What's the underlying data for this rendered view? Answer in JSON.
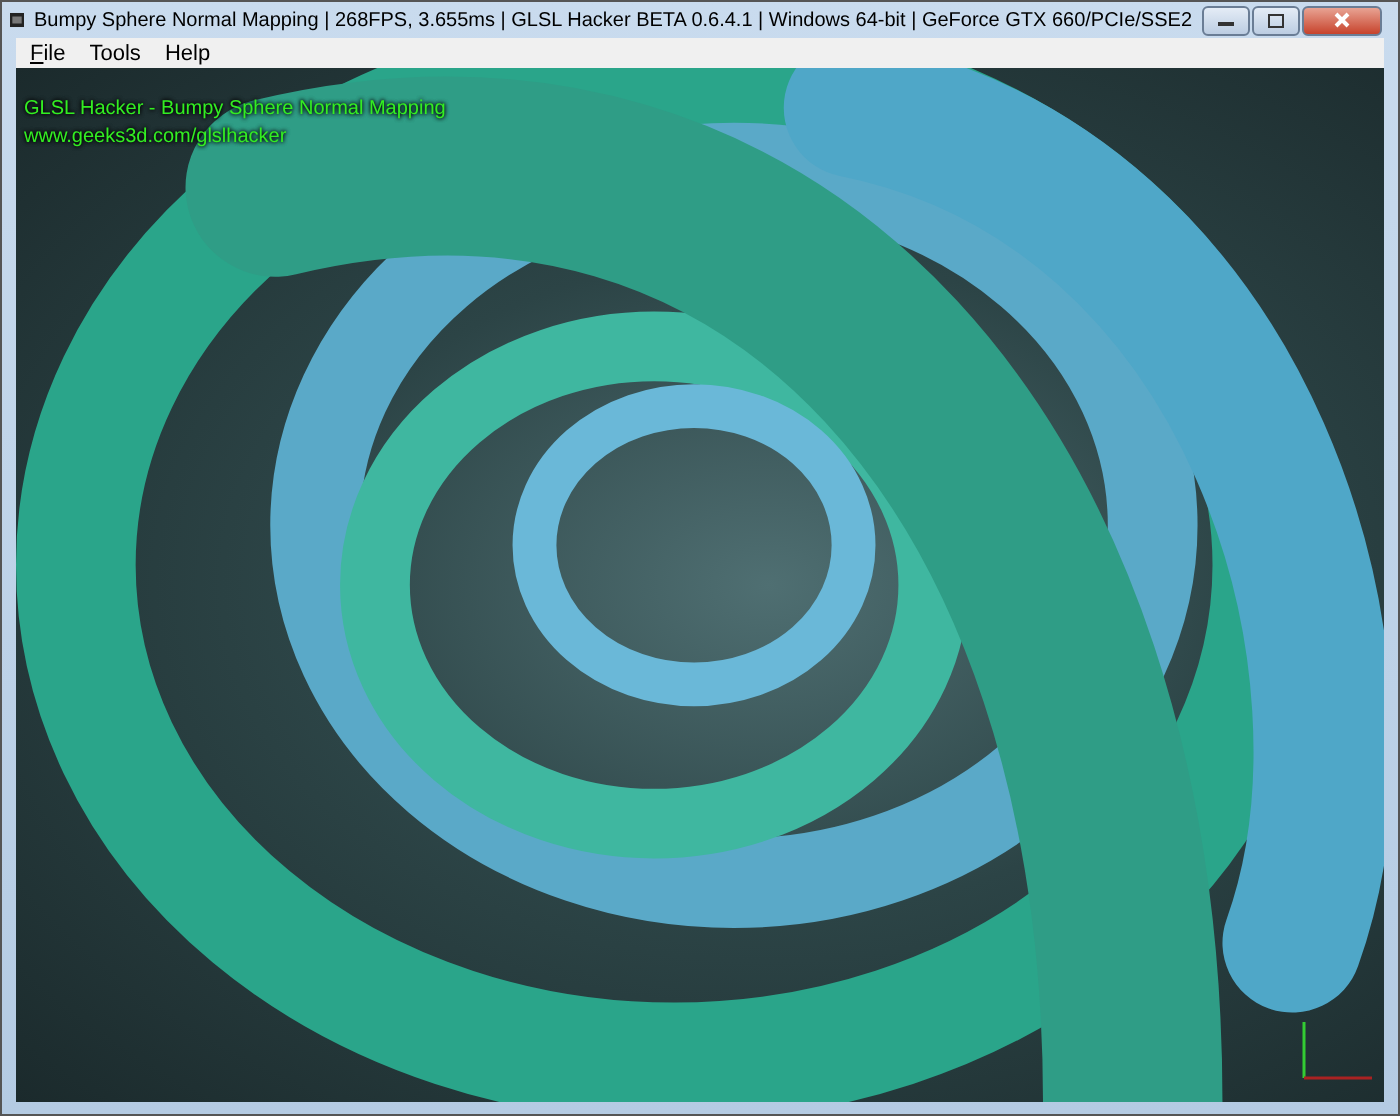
{
  "window": {
    "title": "Bumpy Sphere Normal Mapping | 268FPS, 3.655ms | GLSL Hacker BETA 0.6.4.1 | Windows 64-bit | GeForce GTX 660/PCIe/SSE2"
  },
  "menu": [
    {
      "label": "File",
      "underlined_first_letter": true
    },
    {
      "label": "Tools",
      "underlined_first_letter": false
    },
    {
      "label": "Help",
      "underlined_first_letter": false
    }
  ],
  "viewport": {
    "overlay_lines": [
      "GLSL Hacker - Bumpy Sphere Normal Mapping",
      "www.geeks3d.com/glslhacker"
    ]
  }
}
